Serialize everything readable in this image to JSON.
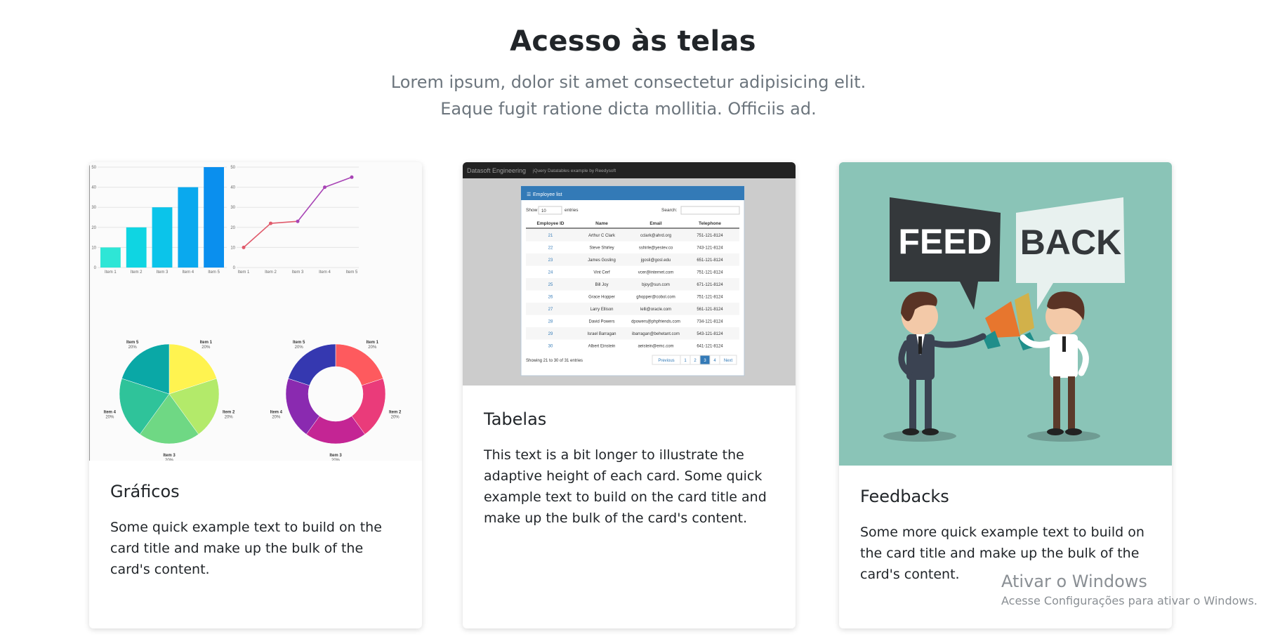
{
  "section": {
    "title": "Acesso às telas",
    "subtitle": "Lorem ipsum, dolor sit amet consectetur adipisicing elit. Eaque fugit ratione dicta mollitia. Officiis ad."
  },
  "cards": [
    {
      "title": "Gráficos",
      "text": "Some quick example text to build on the card title and make up the bulk of the card's content.",
      "image": {
        "bar_chart": {
          "categories": [
            "Item 1",
            "Item 2",
            "Item 3",
            "Item 4",
            "Item 5"
          ],
          "values": [
            10,
            20,
            30,
            40,
            50
          ],
          "ticks": [
            "0",
            "10",
            "20",
            "30",
            "40",
            "50"
          ],
          "colors": [
            "#2ee6d6",
            "#0fd5e2",
            "#0bc4ea",
            "#0aa9ee",
            "#0a8fee"
          ]
        },
        "line_chart": {
          "categories": [
            "Item 1",
            "Item 2",
            "Item 3",
            "Item 4",
            "Item 5"
          ],
          "values": [
            10,
            22,
            23,
            40,
            45
          ],
          "ticks": [
            "0",
            "10",
            "20",
            "30",
            "40",
            "50"
          ],
          "colors": [
            "#e05a6b",
            "#a844b5"
          ]
        },
        "pie_chart": {
          "slices": [
            {
              "label": "Item 1",
              "pct": "20%",
              "color": "#fff350"
            },
            {
              "label": "Item 2",
              "pct": "20%",
              "color": "#b3ea6a"
            },
            {
              "label": "Item 3",
              "pct": "20%",
              "color": "#6fd884"
            },
            {
              "label": "Item 4",
              "pct": "20%",
              "color": "#2fc39a"
            },
            {
              "label": "Item 5",
              "pct": "20%",
              "color": "#0aa8a6"
            }
          ]
        },
        "donut_chart": {
          "slices": [
            {
              "label": "Item 1",
              "pct": "20%",
              "color": "#fe5a5e"
            },
            {
              "label": "Item 2",
              "pct": "20%",
              "color": "#ea3b7a"
            },
            {
              "label": "Item 3",
              "pct": "20%",
              "color": "#c42594"
            },
            {
              "label": "Item 4",
              "pct": "20%",
              "color": "#8a2ab0"
            },
            {
              "label": "Item 5",
              "pct": "20%",
              "color": "#3538b0"
            }
          ]
        }
      }
    },
    {
      "title": "Tabelas",
      "text": "This text is a bit longer to illustrate the adaptive height of each card. Some quick example text to build on the card title and make up the bulk of the card's content.",
      "image": {
        "navbar_brand": "Datasoft Engineering",
        "navbar_subtitle": "jQuery Datatables example by Reedysoft",
        "panel_title": "Employee list",
        "show_label": "Show",
        "show_value": "10",
        "entries_label": "entries",
        "search_label": "Search:",
        "columns": [
          "Employee ID",
          "Name",
          "Email",
          "Telephone"
        ],
        "rows": [
          [
            "21",
            "Arthur C Clark",
            "cclark@ahrd.org",
            "751-121-8124"
          ],
          [
            "22",
            "Steve Shirley",
            "sshirle@yestev.co",
            "743-121-8124"
          ],
          [
            "23",
            "James Gosling",
            "jgosli@gosl.edu",
            "651-121-8124"
          ],
          [
            "24",
            "Vint Cerf",
            "vcer@internet.com",
            "751-121-8124"
          ],
          [
            "25",
            "Bill Joy",
            "bjoy@sun.com",
            "671-121-8124"
          ],
          [
            "26",
            "Grace Hopper",
            "ghopper@cobol.com",
            "751-121-8124"
          ],
          [
            "27",
            "Larry Ellison",
            "lelli@oracle.com",
            "561-121-8124"
          ],
          [
            "28",
            "David Powers",
            "dpowers@phpfriends.com",
            "734-121-8124"
          ],
          [
            "29",
            "Israel Barragan",
            "ibarragan@behetant.com",
            "543-121-8124"
          ],
          [
            "30",
            "Albert Einstein",
            "aeistein@emc.com",
            "641-121-8124"
          ]
        ],
        "info": "Showing 21 to 30 of 31 entries",
        "pagination": [
          "Previous",
          "1",
          "2",
          "3",
          "4",
          "Next"
        ],
        "active_page": "3"
      }
    },
    {
      "title": "Feedbacks",
      "text": "Some more quick example text to build on the card title and make up the bulk of the card's content.",
      "image": {
        "bubble_left": "FEED",
        "bubble_right": "BACK",
        "background": "#8ac4b7"
      }
    }
  ],
  "watermark": {
    "line1": "Ativar o Windows",
    "line2": "Acesse Configurações para ativar o Windows."
  }
}
